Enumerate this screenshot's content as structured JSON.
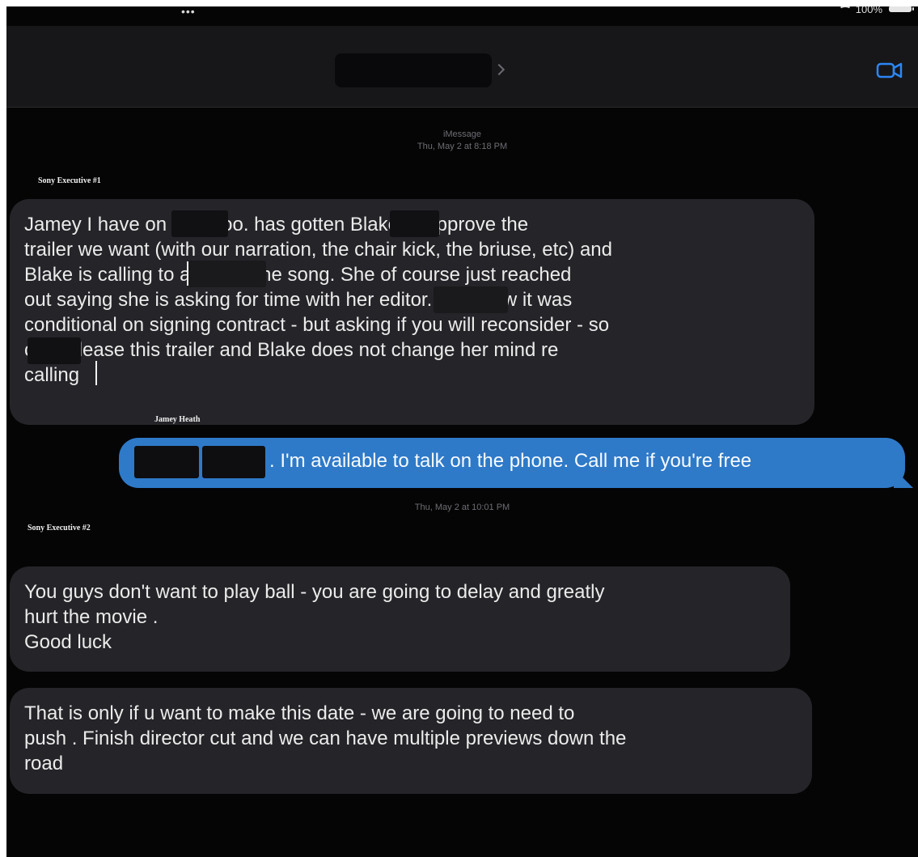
{
  "status_bar": {
    "signal_dots": "•••",
    "battery_text": "100%"
  },
  "header": {
    "video_icon": "video-camera-icon",
    "chevron_icon": "chevron-right-icon"
  },
  "thread": {
    "service_label": "iMessage",
    "timestamp_1": "Thu, May 2 at 8:18 PM",
    "timestamp_2": "Thu, May 2 at 10:01 PM",
    "messages": [
      {
        "sender_label": "Sony Executive #1",
        "lines": [
          "Jamey I have            on here too.          has gotten Blake to approve the",
          "trailer we want (with our narration, the chair kick, the briuse, etc) and",
          "Blake is calling              to approve the song. She of course just reached",
          "out saying she is asking for time with                her editor. We know it was",
          "conditional on signing contract - but asking if you will reconsider - so",
          "           can release this trailer and Blake does not change her mind re",
          "calling"
        ]
      },
      {
        "sender_label": "Jamey Heath",
        "text": ". I'm available to talk on the phone. Call me if you're free"
      },
      {
        "sender_label": "Sony Executive #2",
        "lines": [
          "You guys don't want to play ball - you are going to delay and greatly",
          "hurt the movie .",
          "Good luck"
        ]
      },
      {
        "lines": [
          "That is only if u want to make this date - we are going to need to",
          "push . Finish director cut and we can have multiple previews down the",
          "road"
        ]
      }
    ]
  },
  "colors": {
    "background": "#050506",
    "nav_background": "#17171a",
    "incoming_bubble": "#252529",
    "outgoing_bubble": "#2f79c9",
    "accent_icon": "#2d86f5"
  }
}
